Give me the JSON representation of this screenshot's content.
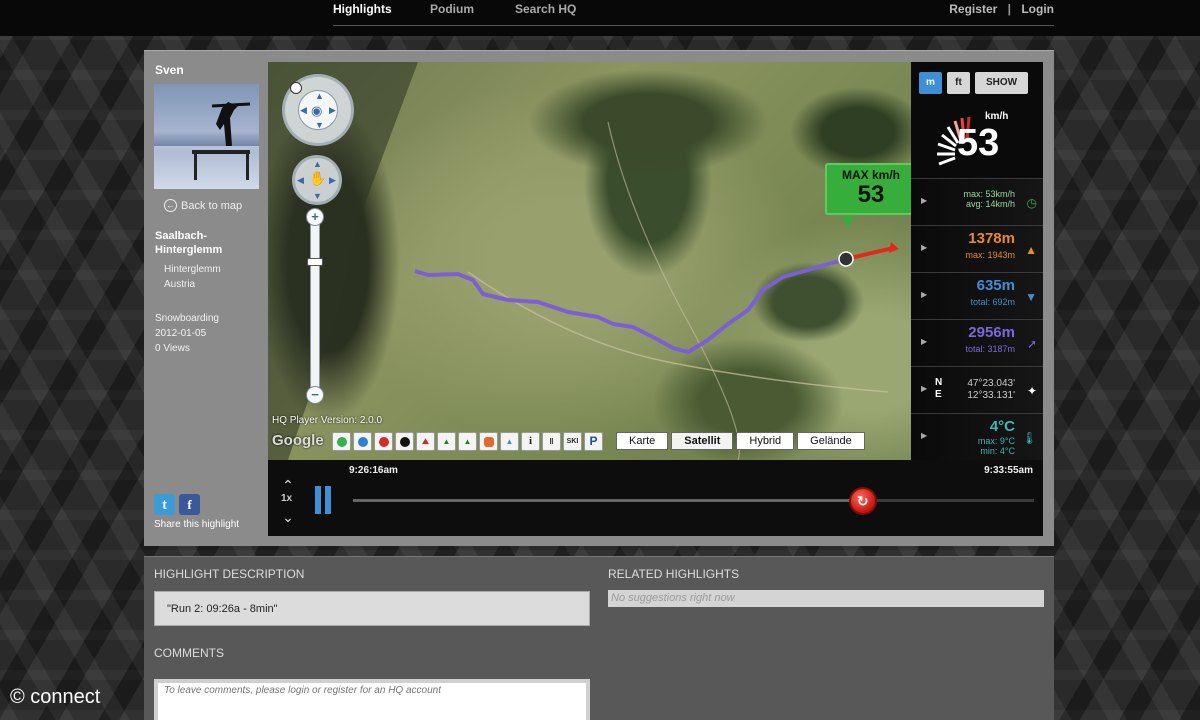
{
  "nav": {
    "items": [
      "Highlights",
      "Podium",
      "Search HQ"
    ],
    "register": "Register",
    "separator": "|",
    "login": "Login"
  },
  "profile": {
    "name": "Sven",
    "back_to_map": "Back to map",
    "location_title_1": "Saalbach-",
    "location_title_2": "Hinterglemm",
    "location_sub_1": "Hinterglemm",
    "location_sub_2": "Austria",
    "sport": "Snowboarding",
    "date": "2012-01-05",
    "views": "0 Views",
    "share_label": "Share this highlight",
    "twitter_glyph": "t",
    "facebook_glyph": "f"
  },
  "map": {
    "player_version": "HQ Player Version: 2.0.0",
    "google": "Google",
    "layer_icons": [
      "green-dot-icon",
      "blue-dot-icon",
      "red-dot-icon",
      "black-dot-icon",
      "ski-lift-icon",
      "tree-icon",
      "tree-icon",
      "hut-icon",
      "mountain-icon",
      "info-icon",
      "restaurant-icon",
      "ski-school-icon",
      "parking-icon"
    ],
    "ski_school_text": "SKI",
    "parking_text": "P",
    "info_text": "i",
    "map_types": [
      "Karte",
      "Satellit",
      "Hybrid",
      "Gelände"
    ],
    "active_map_type": "Satellit",
    "callout_label": "MAX km/h",
    "callout_value": "53"
  },
  "stats": {
    "unit_m": "m",
    "unit_ft": "ft",
    "show": "SHOW",
    "speed_unit": "km/h",
    "speed_value": "53",
    "speed_max": "max: 53km/h",
    "speed_avg": "avg: 14km/h",
    "altitude": "1378m",
    "altitude_max": "max: 1943m",
    "descent": "635m",
    "descent_total": "total: 692m",
    "distance": "2956m",
    "distance_total": "total: 3187m",
    "coord_label_n": "N",
    "coord_label_e": "E",
    "coord_n": "47°23.043'",
    "coord_e": "12°33.131'",
    "temp": "4°C",
    "temp_max": "max: 9°C",
    "temp_min": "min: 4°C",
    "colors": {
      "speed": "#33b34a",
      "altitude": "#e88a2d",
      "descent": "#3f8fd6",
      "distance": "#7b68d8",
      "temp": "#3fb6b0"
    }
  },
  "player": {
    "time_start": "9:26:16am",
    "time_end": "9:33:55am",
    "playback_speed": "1x",
    "progress": 0.75
  },
  "lower": {
    "description_title": "HIGHLIGHT DESCRIPTION",
    "description": "\"Run 2: 09:26a - 8min\"",
    "related_title": "RELATED HIGHLIGHTS",
    "related_placeholder": "No suggestions right now",
    "comments_title": "COMMENTS",
    "comments_placeholder": "To leave comments, please login or register for an HQ account"
  },
  "watermark": "© connect"
}
